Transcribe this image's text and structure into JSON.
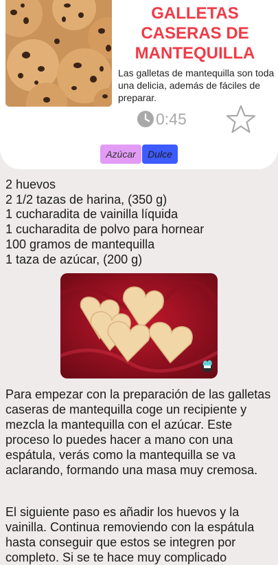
{
  "recipe": {
    "title": "GALLETAS CASERAS DE MANTEQUILLA",
    "description": "Las galletas de mantequilla son toda una delicia, además de fáciles de preparar.",
    "time": "0:45",
    "tags": [
      "Azúcar",
      "Dulce"
    ],
    "ingredients": [
      "2 huevos",
      "2 1/2 tazas de harina, (350 g)",
      "1 cucharadita de vainilla líquida",
      "1 cucharadita de polvo para hornear",
      "100 gramos de mantequilla",
      "1 taza de azúcar, (200 g)"
    ],
    "steps": [
      "Para empezar con la preparación de las galletas caseras de mantequilla coge un recipiente y mezcla la mantequilla con el azúcar. Este proceso lo puedes hacer a mano con una espátula, verás como la mantequilla se va aclarando, formando una masa muy cremosa.",
      "El siguiente paso es añadir los huevos y la vainilla. Continua removiendo con la espátula hasta conseguir que estos se integren por completo. Si se te hace muy complicado"
    ]
  },
  "icons": {
    "clock": "clock-icon",
    "favorite": "star-outline-icon",
    "watermark": "chef-hat-icon"
  },
  "colors": {
    "title": "#ef3b47",
    "tag_azucar": "#e39cf6",
    "tag_dulce": "#3d5bff",
    "time": "#a9a9a9",
    "background": "#efebeb"
  }
}
